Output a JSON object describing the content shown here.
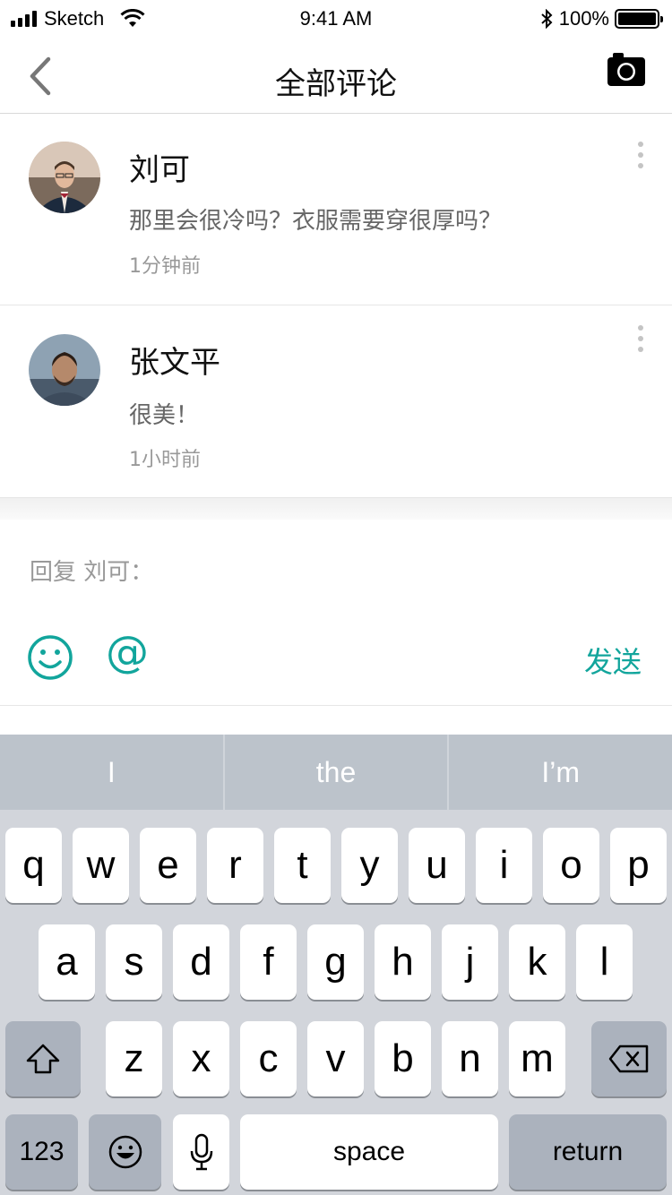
{
  "status_bar": {
    "carrier": "Sketch",
    "time": "9:41 AM",
    "battery": "100%"
  },
  "nav": {
    "title": "全部评论"
  },
  "comments": [
    {
      "name": "刘可",
      "text": "那里会很冷吗？衣服需要穿很厚吗？",
      "time": "1分钟前"
    },
    {
      "name": "张文平",
      "text": "很美！",
      "time": "1小时前"
    }
  ],
  "reply": {
    "prompt": "回复 刘可：",
    "at_label": "@",
    "send_label": "发送"
  },
  "keyboard": {
    "suggestions": [
      "I",
      "the",
      "I’m"
    ],
    "row1": [
      "q",
      "w",
      "e",
      "r",
      "t",
      "y",
      "u",
      "i",
      "o",
      "p"
    ],
    "row2": [
      "a",
      "s",
      "d",
      "f",
      "g",
      "h",
      "j",
      "k",
      "l"
    ],
    "row3": [
      "z",
      "x",
      "c",
      "v",
      "b",
      "n",
      "m"
    ],
    "numbers_label": "123",
    "space_label": "space",
    "return_label": "return"
  },
  "colors": {
    "accent": "#12a59c",
    "keyboard_bg": "#d2d5db",
    "suggestion_bg": "#bcc3cb"
  },
  "icons": [
    "back-chevron-icon",
    "camera-icon",
    "more-vertical-icon",
    "smiley-icon",
    "shift-icon",
    "backspace-icon",
    "emoji-icon",
    "microphone-icon"
  ]
}
